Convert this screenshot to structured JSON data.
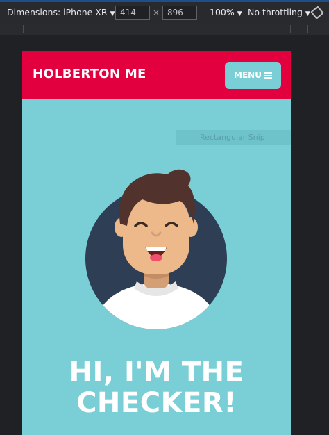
{
  "devtools": {
    "dimensions_label": "Dimensions: iPhone XR",
    "width": "414",
    "height": "896",
    "times": "×",
    "zoom": "100%",
    "throttling": "No throttling"
  },
  "site": {
    "brand": "HOLBERTON ME",
    "menu_label": "MENU",
    "ghost_tooltip": "Rectangular Snip",
    "hero_line1": "HI, I'M THE",
    "hero_line2": "CHECKER!"
  },
  "colors": {
    "header": "#e3003f",
    "background": "#7acfd6",
    "avatar_circle": "#2e3e55",
    "hair": "#51322c",
    "skin": "#edb98a",
    "shirt": "#ffffff"
  }
}
